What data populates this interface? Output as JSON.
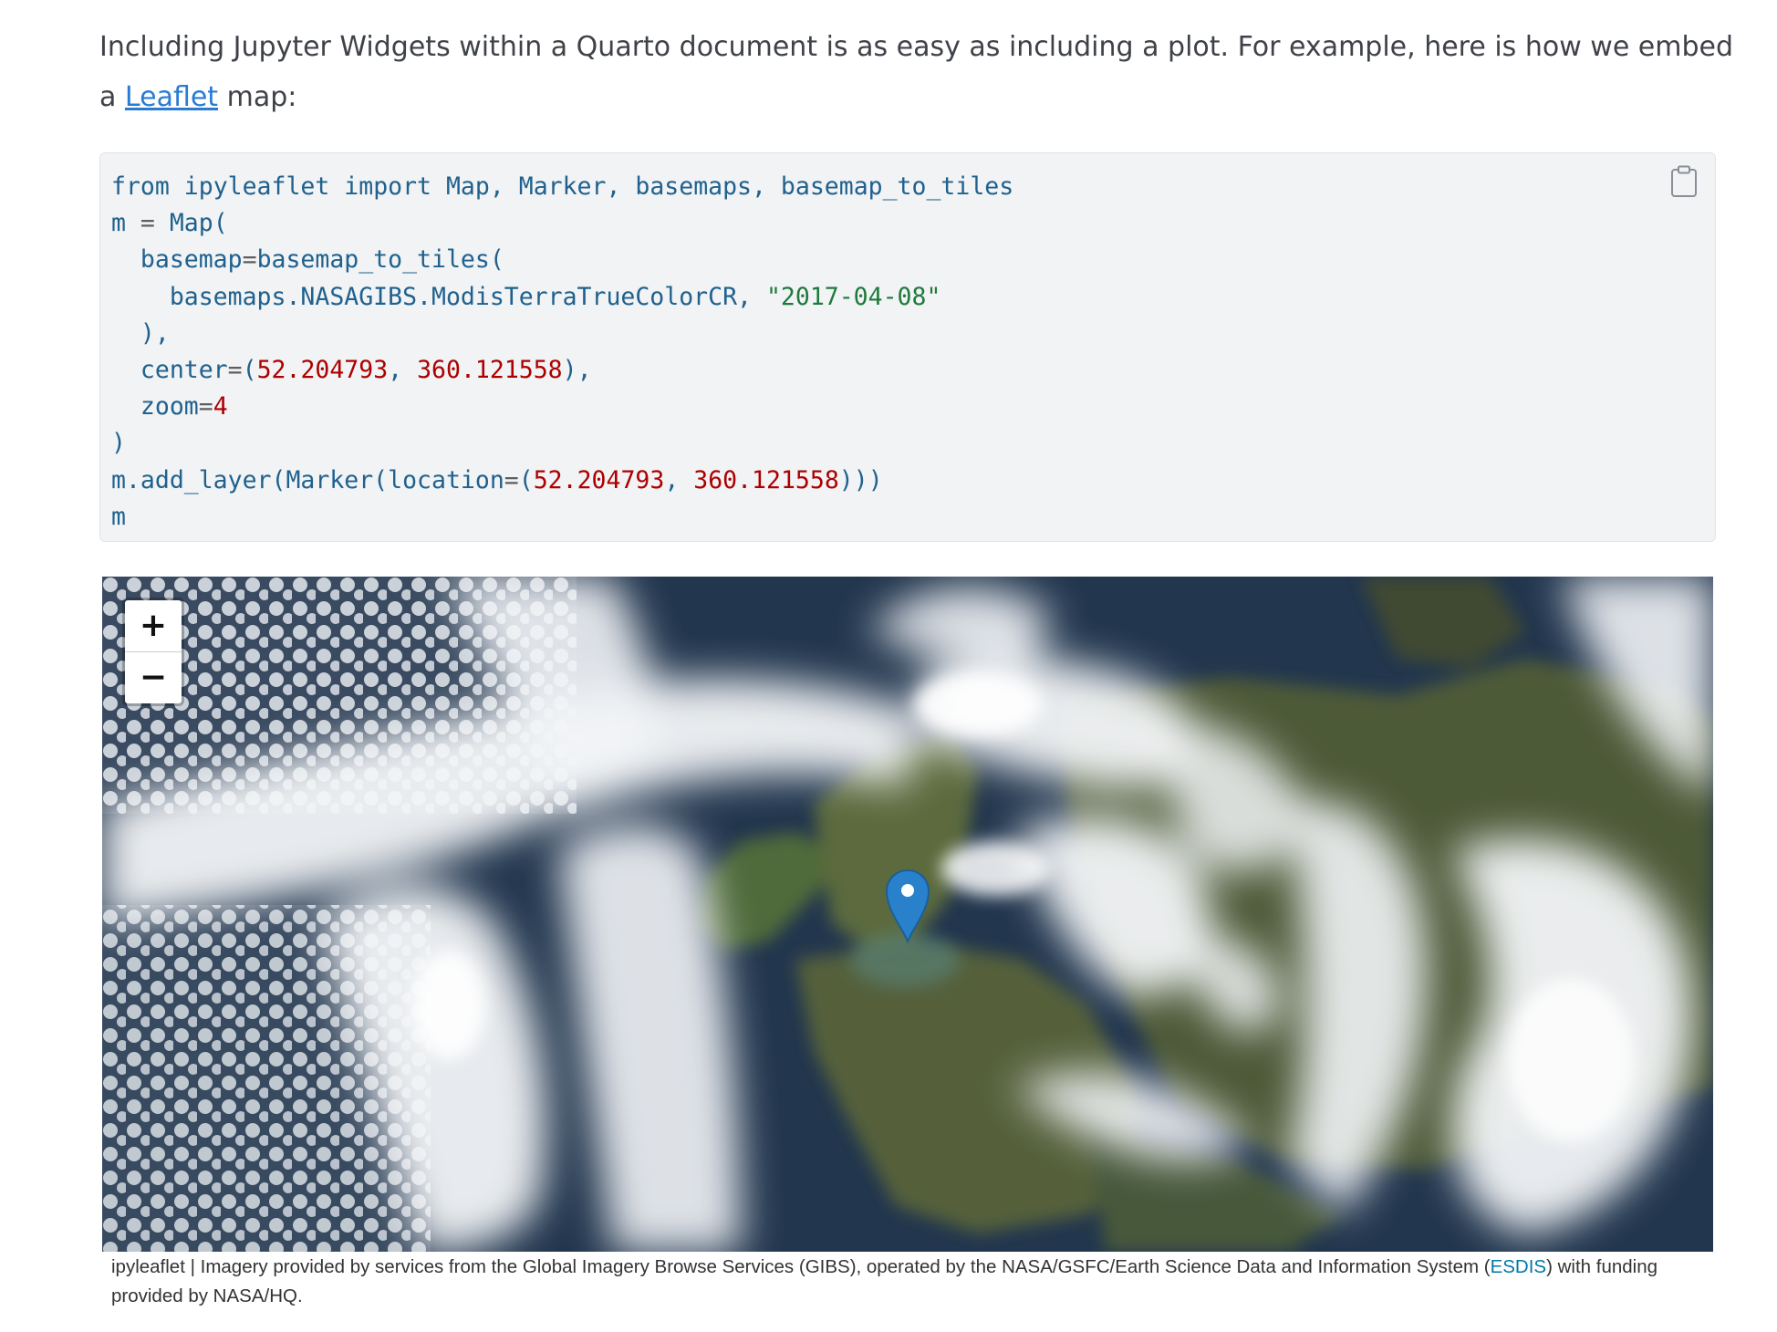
{
  "intro": {
    "text_before": "Including Jupyter Widgets within a Quarto document is as easy as including a plot. For example, here is how we embed a ",
    "link_label": "Leaflet",
    "text_after": " map:"
  },
  "code": {
    "language": "python",
    "lines": [
      [
        {
          "t": "kw",
          "v": "from"
        },
        {
          "t": "plain",
          "v": " ipyleaflet "
        },
        {
          "t": "kw",
          "v": "import"
        },
        {
          "t": "plain",
          "v": " Map, Marker, basemaps, basemap_to_tiles"
        }
      ],
      [
        {
          "t": "plain",
          "v": "m "
        },
        {
          "t": "op",
          "v": "="
        },
        {
          "t": "plain",
          "v": " Map("
        }
      ],
      [
        {
          "t": "plain",
          "v": "  basemap"
        },
        {
          "t": "op",
          "v": "="
        },
        {
          "t": "plain",
          "v": "basemap_to_tiles("
        }
      ],
      [
        {
          "t": "plain",
          "v": "    basemaps.NASAGIBS.ModisTerraTrueColorCR, "
        },
        {
          "t": "str",
          "v": "\"2017-04-08\""
        }
      ],
      [
        {
          "t": "plain",
          "v": "  ),"
        }
      ],
      [
        {
          "t": "plain",
          "v": "  center"
        },
        {
          "t": "op",
          "v": "="
        },
        {
          "t": "plain",
          "v": "("
        },
        {
          "t": "num",
          "v": "52.204793"
        },
        {
          "t": "plain",
          "v": ", "
        },
        {
          "t": "num",
          "v": "360.121558"
        },
        {
          "t": "plain",
          "v": "),"
        }
      ],
      [
        {
          "t": "plain",
          "v": "  zoom"
        },
        {
          "t": "op",
          "v": "="
        },
        {
          "t": "num",
          "v": "4"
        }
      ],
      [
        {
          "t": "plain",
          "v": ")"
        }
      ],
      [
        {
          "t": "plain",
          "v": "m.add_layer(Marker(location"
        },
        {
          "t": "op",
          "v": "="
        },
        {
          "t": "plain",
          "v": "("
        },
        {
          "t": "num",
          "v": "52.204793"
        },
        {
          "t": "plain",
          "v": ", "
        },
        {
          "t": "num",
          "v": "360.121558"
        },
        {
          "t": "plain",
          "v": ")))"
        }
      ],
      [
        {
          "t": "plain",
          "v": "m"
        }
      ]
    ],
    "copy_icon": "clipboard-icon"
  },
  "map": {
    "zoom_in_label": "+",
    "zoom_out_label": "−",
    "marker_icon": "map-pin-icon"
  },
  "attribution": {
    "prefix": "ipyleaflet | Imagery provided by services from the Global Imagery Browse Services (GIBS), operated by the NASA/GSFC/Earth Science Data and Information System (",
    "link_label": "ESDIS",
    "suffix": ") with funding provided by NASA/HQ."
  },
  "colors": {
    "link": "#2a7bd3",
    "code_bg": "#f1f3f5",
    "code_text": "#20618d",
    "code_string": "#1f7a3c",
    "code_number": "#ad0000",
    "marker": "#2a81cb"
  }
}
